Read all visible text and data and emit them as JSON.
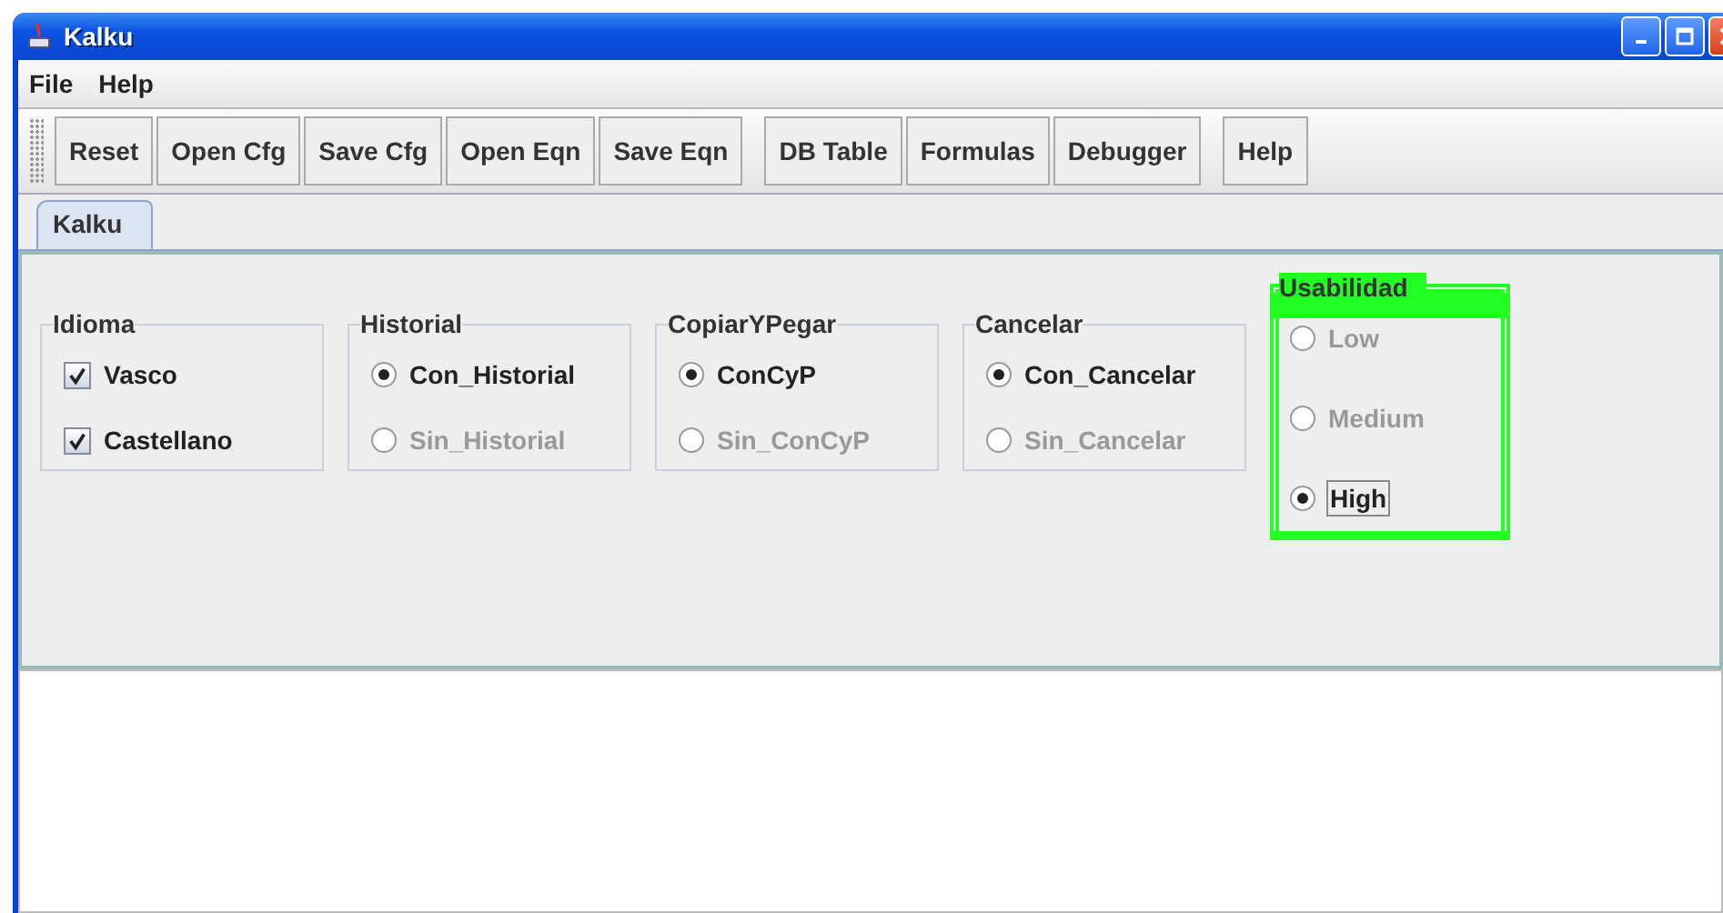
{
  "window": {
    "title": "Kalku"
  },
  "menu": [
    "File",
    "Help"
  ],
  "toolbar_groups": [
    [
      "Reset",
      "Open Cfg",
      "Save Cfg",
      "Open Eqn",
      "Save Eqn"
    ],
    [
      "DB Table",
      "Formulas",
      "Debugger"
    ],
    [
      "Help"
    ]
  ],
  "tabs": [
    {
      "label": "Kalku",
      "selected": true
    }
  ],
  "groups": [
    {
      "title": "Idioma",
      "kind": "checkbox",
      "highlighted": false,
      "options": [
        {
          "label": "Vasco",
          "checked": true,
          "disabled": false,
          "focused": false
        },
        {
          "label": "Castellano",
          "checked": true,
          "disabled": false,
          "focused": false
        }
      ]
    },
    {
      "title": "Historial",
      "kind": "radio",
      "highlighted": false,
      "options": [
        {
          "label": "Con_Historial",
          "selected": true,
          "disabled": false,
          "focused": false
        },
        {
          "label": "Sin_Historial",
          "selected": false,
          "disabled": true,
          "focused": false
        }
      ]
    },
    {
      "title": "CopiarYPegar",
      "kind": "radio",
      "highlighted": false,
      "options": [
        {
          "label": "ConCyP",
          "selected": true,
          "disabled": false,
          "focused": false
        },
        {
          "label": "Sin_ConCyP",
          "selected": false,
          "disabled": true,
          "focused": false
        }
      ]
    },
    {
      "title": "Cancelar",
      "kind": "radio",
      "highlighted": false,
      "options": [
        {
          "label": "Con_Cancelar",
          "selected": true,
          "disabled": false,
          "focused": false
        },
        {
          "label": "Sin_Cancelar",
          "selected": false,
          "disabled": true,
          "focused": false
        }
      ]
    },
    {
      "title": "Usabilidad",
      "kind": "radio",
      "highlighted": true,
      "options": [
        {
          "label": "Low",
          "selected": false,
          "disabled": true,
          "focused": false
        },
        {
          "label": "Medium",
          "selected": false,
          "disabled": true,
          "focused": false
        },
        {
          "label": "High",
          "selected": true,
          "disabled": false,
          "focused": true
        }
      ]
    }
  ]
}
